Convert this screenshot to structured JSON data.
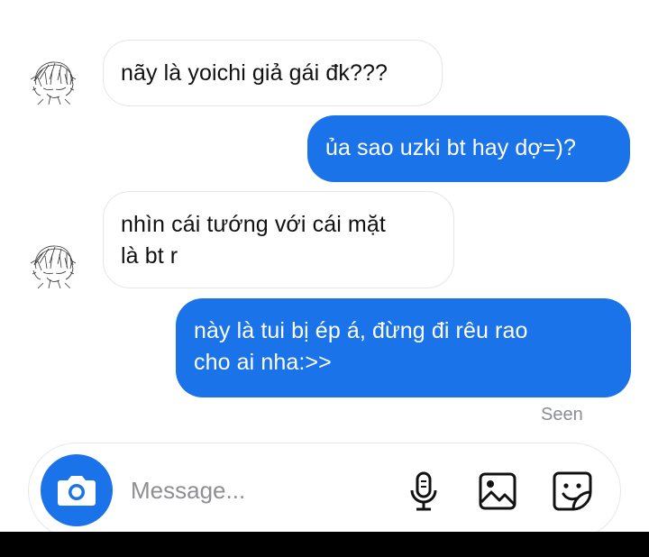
{
  "conversation": {
    "messages": [
      {
        "direction": "incoming",
        "lines": [
          "nãy là yoichi giả gái đk???"
        ]
      },
      {
        "direction": "outgoing",
        "lines": [
          "ủa sao uzki bt hay dợ=)?"
        ]
      },
      {
        "direction": "incoming",
        "lines": [
          "nhìn cái tướng với cái mặt",
          "là bt r"
        ]
      },
      {
        "direction": "outgoing",
        "lines": [
          "này là tui bị ép á, đừng đi rêu rao",
          "cho ai nha:>>"
        ]
      }
    ],
    "seen_label": "Seen"
  },
  "composer": {
    "placeholder": "Message...",
    "icons": {
      "camera": "camera-icon",
      "mic": "microphone-icon",
      "gallery": "image-icon",
      "sticker": "sticker-icon"
    }
  },
  "colors": {
    "outgoing_bubble": "#1a73e8",
    "incoming_border": "#e4e6eb",
    "seen_text": "#8a8d91",
    "placeholder_text": "#8e8e93"
  }
}
